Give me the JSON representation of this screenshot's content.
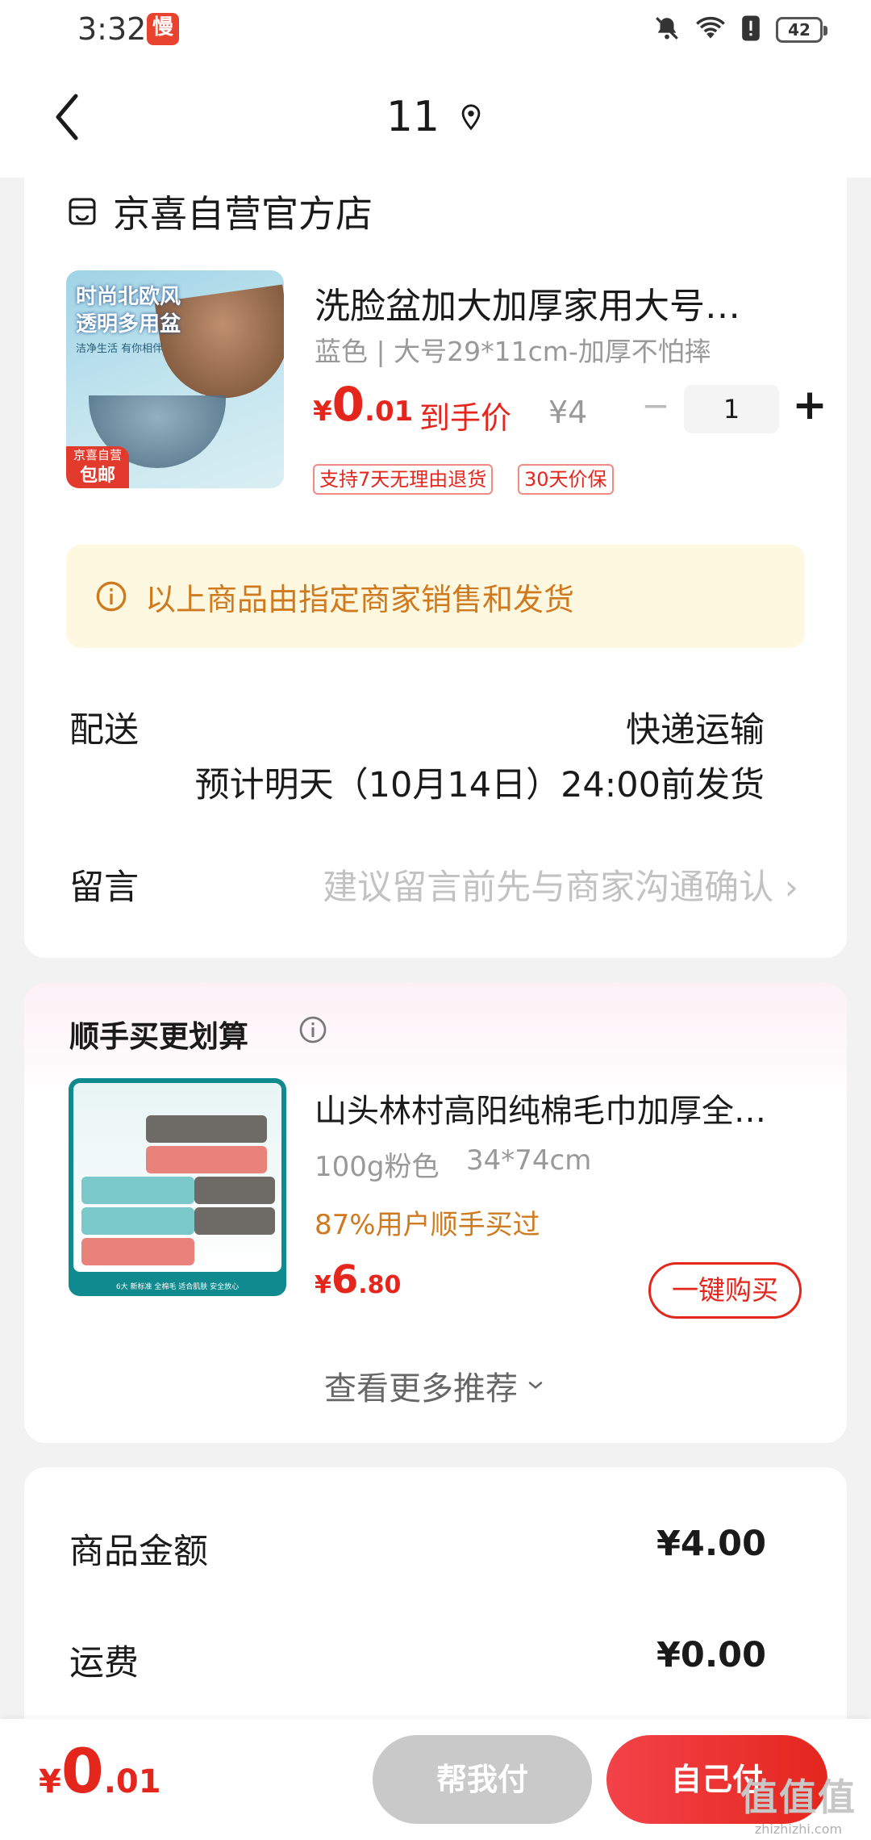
{
  "status_bar": {
    "time": "3:32",
    "app_badge": "慢",
    "battery": "42"
  },
  "nav": {
    "title": "11"
  },
  "store": {
    "name": "京喜自营官方店",
    "product": {
      "image_text_line1": "时尚北欧风",
      "image_text_line2": "透明多用盆",
      "image_subtext": "洁净生活 有你相伴",
      "badge_top": "京喜自营",
      "badge_bottom": "包邮",
      "title": "洗脸盆加大加厚家用大号…",
      "spec": "蓝色 | 大号29*11cm-加厚不怕摔",
      "price_currency": "¥",
      "price_int": "0",
      "price_dec": ".01",
      "price_label": "到手价",
      "original_price": "¥4",
      "quantity": "1",
      "minus": "−",
      "plus": "+",
      "tags": [
        "支持7天无理由退货",
        "30天价保"
      ]
    },
    "notice": "以上商品由指定商家销售和发货",
    "shipping": {
      "label": "配送",
      "method": "快递运输",
      "estimate": "预计明天（10月14日）24:00前发货"
    },
    "message": {
      "label": "留言",
      "placeholder": "建议留言前先与商家沟通确认"
    }
  },
  "recommend": {
    "title": "顺手买更划算",
    "image_footer": "6大 新标准 全棉毛 适合肌肤 安全放心",
    "item": {
      "name": "山头林村高阳纯棉毛巾加厚全…",
      "spec_color": "100g粉色",
      "spec_size": "34*74cm",
      "promo": "87%用户顺手买过",
      "price_currency": "¥",
      "price_int": "6",
      "price_dec": ".80",
      "buy_label": "一键购买"
    },
    "more_label": "查看更多推荐"
  },
  "summary": {
    "goods_label": "商品金额",
    "goods_value": "¥4.00",
    "shipping_label": "运费",
    "shipping_value": "¥0.00"
  },
  "bottom": {
    "total_currency": "¥",
    "total_int": "0",
    "total_dec": ".01",
    "help_pay_label": "帮我付",
    "self_pay_label": "自己付",
    "watermark_glyphs": "值值值",
    "watermark_url": "zhizhizhi.com"
  },
  "colors": {
    "price_red": "#e4261d",
    "notice_bg": "#fff8e1",
    "notice_text": "#d07a1f",
    "disabled_button": "#c9c9c9"
  },
  "icons": [
    "back-arrow-icon",
    "location-pin-icon",
    "store-icon",
    "info-circle-icon",
    "chevron-right-icon",
    "chevron-down-icon",
    "bell-mute-icon",
    "wifi-icon",
    "alert-icon",
    "battery-icon"
  ]
}
